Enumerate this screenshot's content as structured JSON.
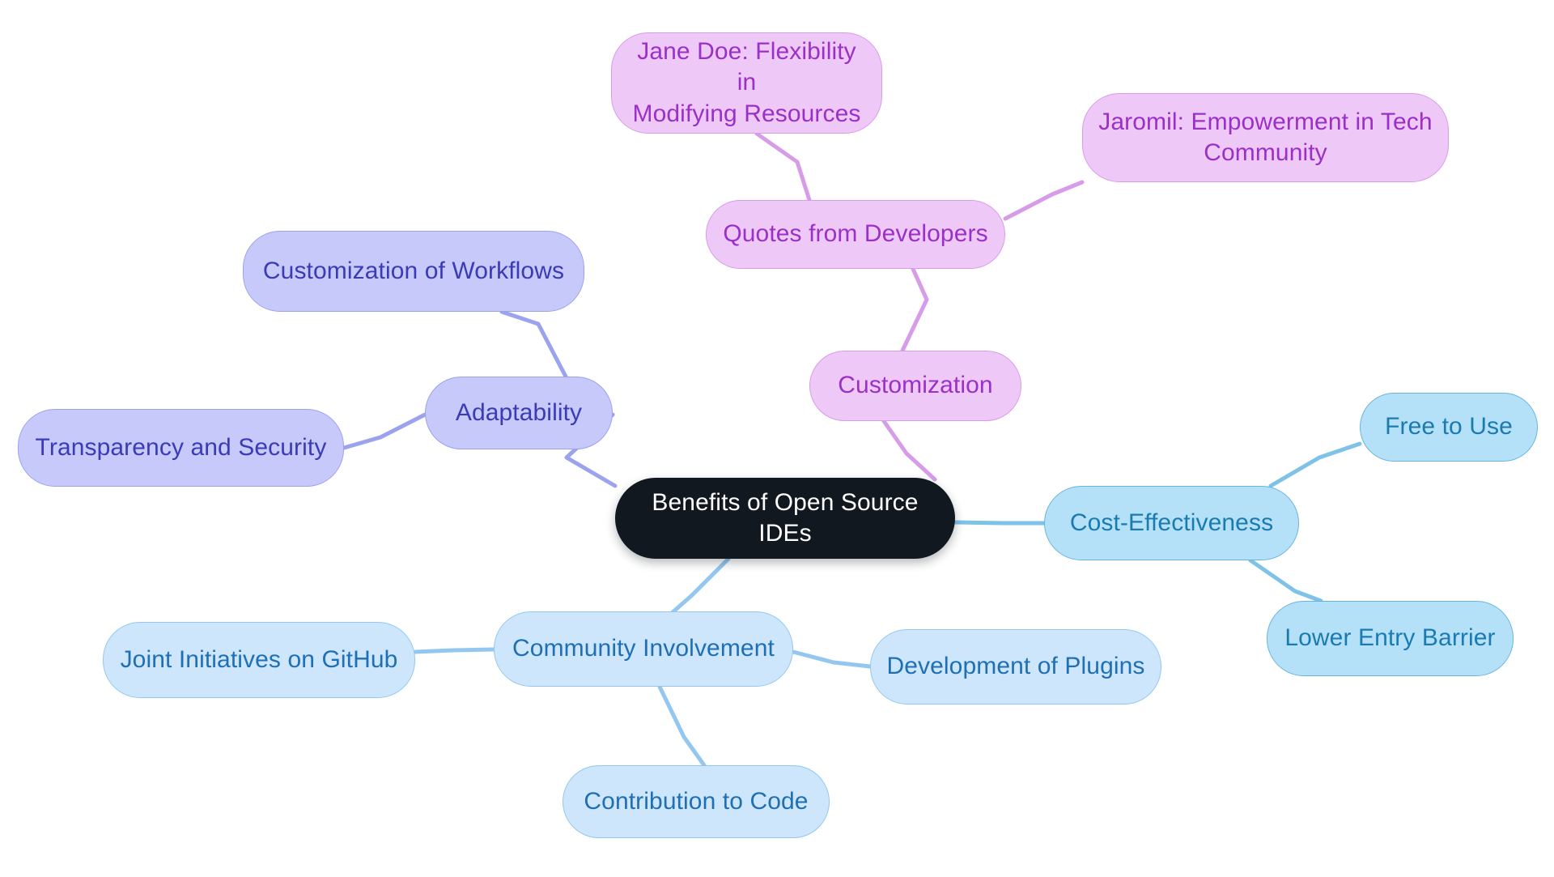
{
  "diagram": {
    "type": "mindmap",
    "title": "Benefits of Open Source IDEs",
    "background_color": "#ffffff",
    "root": {
      "id": "root",
      "label": "Benefits of Open Source IDEs",
      "fill": "#121820",
      "text_color": "#ffffff"
    },
    "branches": [
      {
        "id": "adaptability",
        "label": "Adaptability",
        "fill": "#c6c9f9",
        "border": "#9ba3ef",
        "text_color": "#3a3bb5",
        "edge_color": "#9ba3ef",
        "children": [
          {
            "id": "customization-of-workflows",
            "label": "Customization of Workflows"
          },
          {
            "id": "transparency-and-security",
            "label": "Transparency and Security"
          }
        ]
      },
      {
        "id": "customization",
        "label": "Customization",
        "fill": "#eec9f7",
        "border": "#d79ce8",
        "text_color": "#9b30c9",
        "edge_color": "#d79ce8",
        "children": [
          {
            "id": "quotes-from-developers",
            "label": "Quotes from Developers",
            "children": [
              {
                "id": "jane-doe-flexibility",
                "label": "Jane Doe: Flexibility in\nModifying Resources"
              },
              {
                "id": "jaromil-empowerment",
                "label": "Jaromil: Empowerment in Tech\nCommunity"
              }
            ]
          }
        ]
      },
      {
        "id": "cost-effectiveness",
        "label": "Cost-Effectiveness",
        "fill": "#b5e1f8",
        "border": "#68b4dd",
        "text_color": "#1a7bb0",
        "edge_color": "#7ec2e8",
        "children": [
          {
            "id": "free-to-use",
            "label": "Free to Use"
          },
          {
            "id": "lower-entry-barrier",
            "label": "Lower Entry Barrier"
          }
        ]
      },
      {
        "id": "community-involvement",
        "label": "Community Involvement",
        "fill": "#cde6fb",
        "border": "#93c7ef",
        "text_color": "#1f6fb5",
        "edge_color": "#93c7ef",
        "children": [
          {
            "id": "joint-initiatives-on-github",
            "label": "Joint Initiatives on GitHub"
          },
          {
            "id": "development-of-plugins",
            "label": "Development of Plugins"
          },
          {
            "id": "contribution-to-code",
            "label": "Contribution to Code"
          }
        ]
      }
    ],
    "nodes": {
      "root": {
        "label": "Benefits of Open Source IDEs"
      },
      "jane_doe": {
        "label": "Jane Doe: Flexibility in\nModifying Resources"
      },
      "jaromil": {
        "label": "Jaromil: Empowerment in Tech\nCommunity"
      },
      "quotes": {
        "label": "Quotes from Developers"
      },
      "customization": {
        "label": "Customization"
      },
      "customization_workflows": {
        "label": "Customization of Workflows"
      },
      "adaptability": {
        "label": "Adaptability"
      },
      "transparency": {
        "label": "Transparency and Security"
      },
      "cost": {
        "label": "Cost-Effectiveness"
      },
      "free": {
        "label": "Free to Use"
      },
      "lower_barrier": {
        "label": "Lower Entry Barrier"
      },
      "community": {
        "label": "Community Involvement"
      },
      "github": {
        "label": "Joint Initiatives on GitHub"
      },
      "plugins": {
        "label": "Development of Plugins"
      },
      "contribution": {
        "label": "Contribution to Code"
      }
    }
  }
}
